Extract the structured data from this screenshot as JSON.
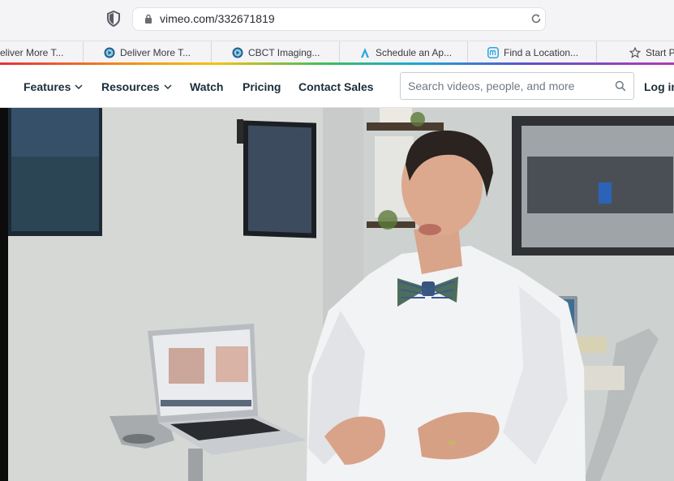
{
  "browser": {
    "url": "vimeo.com/332671819",
    "bookmarks": [
      {
        "label": "eliver More T...",
        "icon": "none"
      },
      {
        "label": "Deliver More T...",
        "icon": "play-circle-icon"
      },
      {
        "label": "CBCT Imaging...",
        "icon": "play-circle-icon"
      },
      {
        "label": "Schedule an Ap...",
        "icon": "a-logo-icon"
      },
      {
        "label": "Find a Location...",
        "icon": "m-logo-icon"
      },
      {
        "label": "Start P",
        "icon": "star-icon"
      }
    ]
  },
  "nav": {
    "features": "Features",
    "resources": "Resources",
    "watch": "Watch",
    "pricing": "Pricing",
    "contact": "Contact Sales",
    "search_placeholder": "Search videos, people, and more",
    "login": "Log in"
  },
  "colors": {
    "nav_text": "#1a2e3b",
    "rainbow": [
      "#e6303d",
      "#f28a1a",
      "#f5c20f",
      "#3dbf5a",
      "#1aa9d8",
      "#5a53c8",
      "#b23ab8"
    ]
  }
}
